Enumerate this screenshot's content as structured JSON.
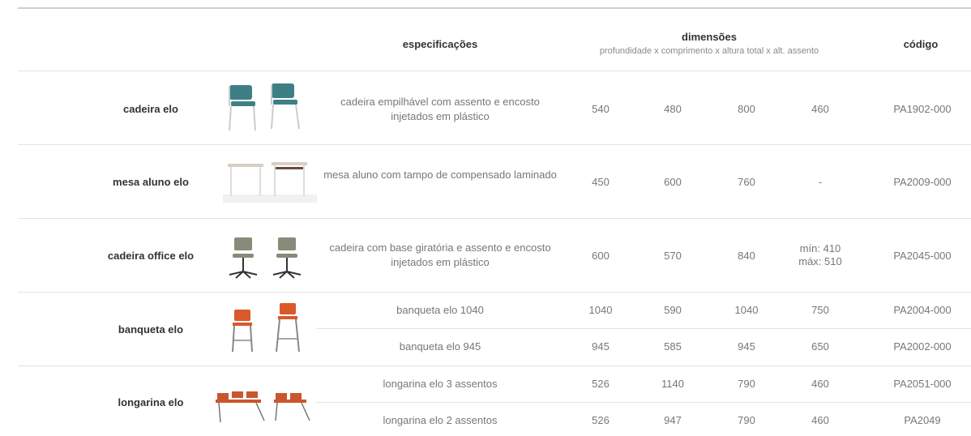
{
  "header": {
    "specs_label": "especificações",
    "dimensions_label": "dimensões",
    "dimensions_sub": "profundidade x comprimento x altura total x alt. assento",
    "code_label": "código"
  },
  "products": [
    {
      "name": "cadeira elo",
      "image_icon": "stacking-chair-pair-icon",
      "variants": [
        {
          "desc": "cadeira empilhável com assento e encosto injetados em plástico",
          "d1": "540",
          "d2": "480",
          "d3": "800",
          "d4": "460",
          "code": "PA1902-000"
        }
      ]
    },
    {
      "name": "mesa aluno elo",
      "image_icon": "student-desk-pair-icon",
      "variants": [
        {
          "desc": "mesa aluno com tampo de compensado laminado",
          "d1": "450",
          "d2": "600",
          "d3": "760",
          "d4": "-",
          "code": "PA2009-000"
        }
      ]
    },
    {
      "name": "cadeira office elo",
      "image_icon": "office-chair-pair-icon",
      "variants": [
        {
          "desc": "cadeira com base giratória e assento e encosto injetados em plástico",
          "d1": "600",
          "d2": "570",
          "d3": "840",
          "d4a": "mín: 410",
          "d4b": "máx: 510",
          "code": "PA2045-000"
        }
      ]
    },
    {
      "name": "banqueta elo",
      "image_icon": "bar-stool-pair-icon",
      "variants": [
        {
          "desc": "banqueta elo 1040",
          "d1": "1040",
          "d2": "590",
          "d3": "1040",
          "d4": "750",
          "code": "PA2004-000"
        },
        {
          "desc": "banqueta elo 945",
          "d1": "945",
          "d2": "585",
          "d3": "945",
          "d4": "650",
          "code": "PA2002-000"
        }
      ]
    },
    {
      "name": "longarina elo",
      "image_icon": "beam-seating-icon",
      "variants": [
        {
          "desc": "longarina elo 3 assentos",
          "d1": "526",
          "d2": "1140",
          "d3": "790",
          "d4": "460",
          "code": "PA2051-000"
        },
        {
          "desc": "longarina elo 2 assentos",
          "d1": "526",
          "d2": "947",
          "d3": "790",
          "d4": "460",
          "code": "PA2049"
        }
      ]
    }
  ],
  "colors": {
    "chair_teal": "#3e7f86",
    "desk_top": "#d8cfc2",
    "office_gray": "#8a8a7a",
    "stool_orange": "#d9592a",
    "beam_orange": "#c9562e"
  }
}
